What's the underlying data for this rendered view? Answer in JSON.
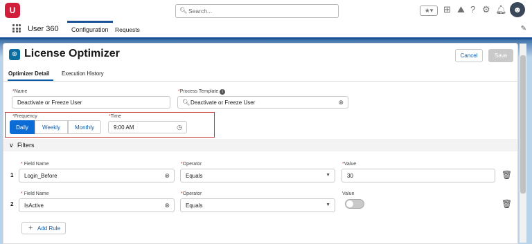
{
  "header": {
    "logo_text": "U",
    "search_placeholder": "Search...",
    "avatar_glyph": "☻"
  },
  "nav": {
    "app_name": "User 360",
    "tabs": [
      {
        "label": "Configuration",
        "active": true
      },
      {
        "label": "Requests",
        "active": false
      }
    ]
  },
  "record": {
    "title": "License Optimizer",
    "cancel_label": "Cancel",
    "save_label": "Save",
    "subtabs": [
      {
        "label": "Optimizer Detail",
        "active": true
      },
      {
        "label": "Execution History",
        "active": false
      }
    ]
  },
  "form": {
    "name_label": "Name",
    "name_value": "Deactivate or Freeze User",
    "process_label": "Process Template",
    "process_value": "Deactivate or Freeze User",
    "frequency_label": "Frequency",
    "frequency_options": [
      "Daily",
      "Weekly",
      "Monthly"
    ],
    "frequency_selected": "Daily",
    "time_label": "Time",
    "time_value": "9:00 AM"
  },
  "filters": {
    "section_label": "Filters",
    "rows": [
      {
        "num": "1",
        "field_label": "Field Name",
        "field_value": "Login_Before",
        "operator_label": "Operator",
        "operator_value": "Equals",
        "value_label": "Value",
        "value": "30"
      },
      {
        "num": "2",
        "field_label": "Field Name",
        "field_value": "IsActive",
        "operator_label": "Operator",
        "operator_value": "Equals",
        "value_label": "Value",
        "toggle_on": false
      }
    ],
    "add_rule_label": "Add Rule"
  },
  "colors": {
    "brand": "#1b5297",
    "accent": "#0b6cd6",
    "highlight_border": "#c23934"
  }
}
